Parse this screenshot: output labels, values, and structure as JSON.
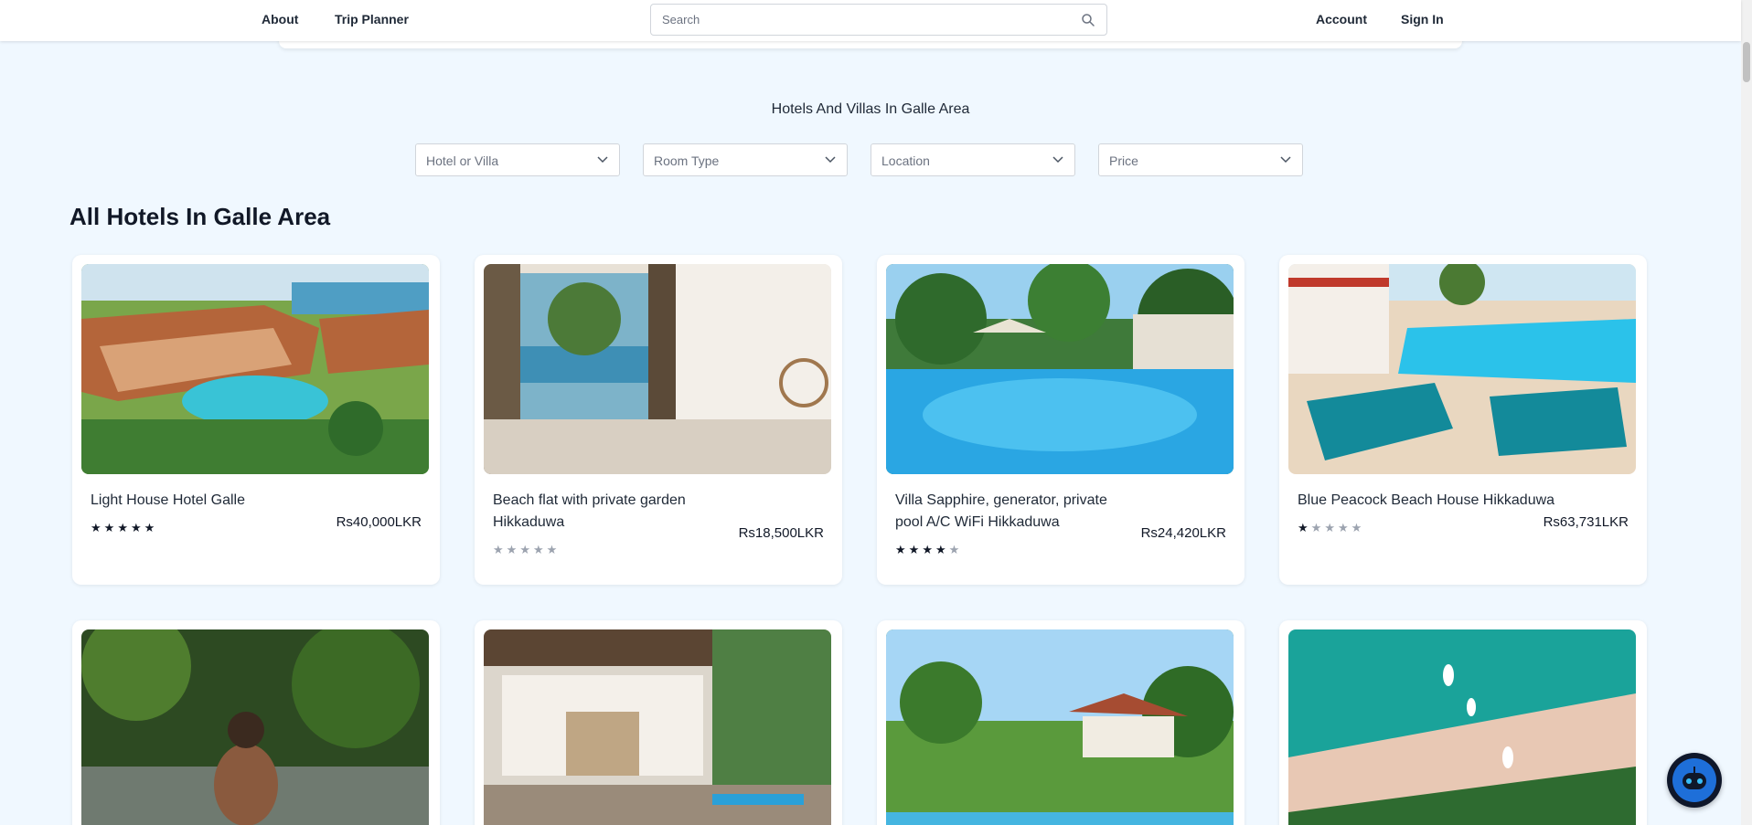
{
  "nav": {
    "about": "About",
    "trip_planner": "Trip Planner",
    "search_placeholder": "Search",
    "account": "Account",
    "sign_in": "Sign In"
  },
  "section_title": "Hotels And Villas In Galle Area",
  "filters": [
    "Hotel or Villa",
    "Room Type",
    "Location",
    "Price"
  ],
  "page_heading": "All Hotels In Galle Area",
  "hotels": [
    {
      "name": "Light House Hotel Galle",
      "price": "Rs40,000LKR",
      "rating": 5,
      "image": "hotel-pool-aerial"
    },
    {
      "name": "Beach flat with private garden Hikkaduwa",
      "price": "Rs18,500LKR",
      "rating": 0.5,
      "image": "room-sea-view"
    },
    {
      "name": "Villa Sapphire, generator, private pool A/C WiFi Hikkaduwa",
      "price": "Rs24,420LKR",
      "rating": 4.5,
      "image": "villa-pool"
    },
    {
      "name": "Blue Peacock Beach House Hikkaduwa",
      "price": "Rs63,731LKR",
      "rating": 1.5,
      "image": "beach-house-pool"
    }
  ],
  "row2_images": [
    "jungle-bath",
    "villa-interior-patio",
    "garden-villa",
    "beach-aerial"
  ],
  "colors": {
    "background": "#f0f8ff",
    "chatbot": "#0f172a",
    "accent": "#0ea5e9"
  },
  "icons": {
    "search": "search-icon",
    "chevron": "chevron-down-icon",
    "chatbot": "chatbot-icon"
  }
}
